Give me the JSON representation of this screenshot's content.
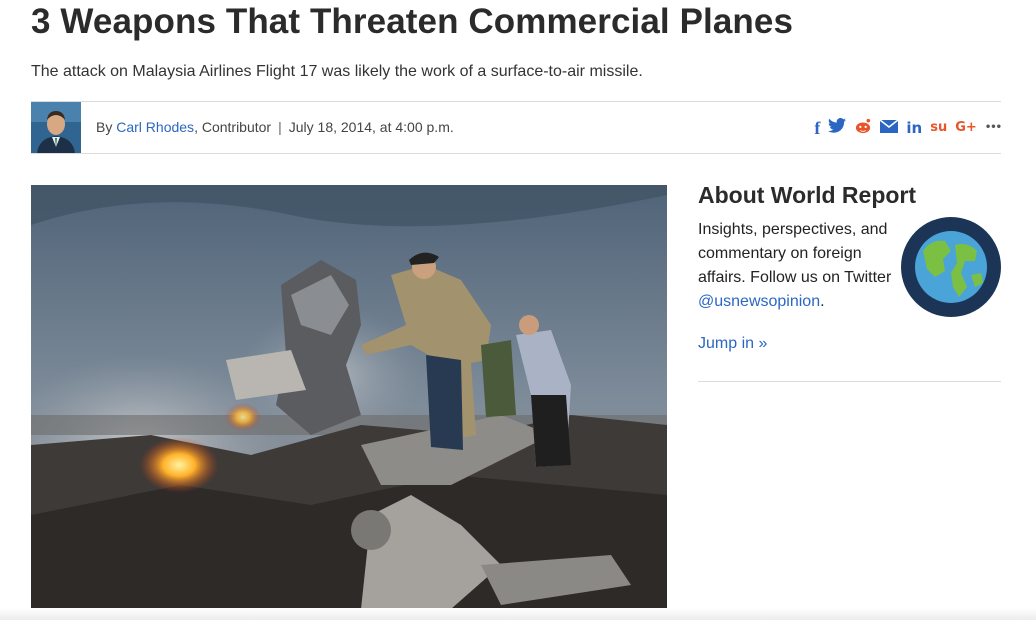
{
  "article": {
    "title": "3 Weapons That Threaten Commercial Planes",
    "subtitle": "The attack on Malaysia Airlines Flight 17 was likely the work of a surface-to-air missile."
  },
  "byline": {
    "prefix": "By ",
    "author": "Carl Rhodes",
    "role": ", Contributor",
    "separator": "|",
    "date": "July 18, 2014, at 4:00 p.m."
  },
  "share": {
    "facebook": "f",
    "twitter": "🐦",
    "reddit": "●",
    "email": "✉",
    "linkedin": "in",
    "stumbleupon": "su",
    "googleplus": "G+",
    "more": "•••"
  },
  "sidebar": {
    "heading": "About World Report",
    "body": "Insights, perspectives, and commentary on foreign affairs. Follow us on Twitter ",
    "handle": "@usnewsopinion",
    "period": ".",
    "jump_label": "Jump in »"
  },
  "colors": {
    "link": "#2a67c4",
    "share_blue": "#2a66c2",
    "share_orange": "#e8552a",
    "globe_bg": "#1c3557"
  }
}
